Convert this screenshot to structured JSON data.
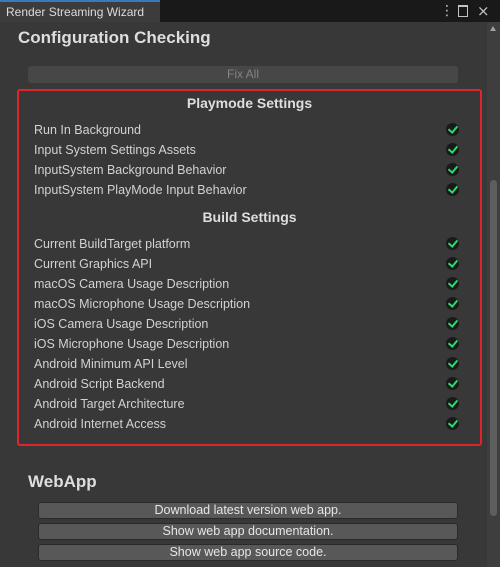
{
  "window": {
    "tab_title": "Render Streaming Wizard",
    "controls": {
      "more": "⋮",
      "close": "×"
    }
  },
  "config": {
    "title": "Configuration Checking",
    "fix_all_label": "Fix All",
    "playmode": {
      "title": "Playmode Settings",
      "items": [
        "Run In Background",
        "Input System Settings Assets",
        "InputSystem Background Behavior",
        "InputSystem PlayMode Input Behavior"
      ]
    },
    "build": {
      "title": "Build Settings",
      "items": [
        "Current BuildTarget platform",
        "Current Graphics API",
        "macOS Camera Usage Description",
        "macOS Microphone Usage Description",
        "iOS Camera Usage Description",
        "iOS Microphone Usage Description",
        "Android Minimum API Level",
        "Android Script Backend",
        "Android Target Architecture",
        "Android Internet Access"
      ]
    },
    "status_icon": "check-circle-icon",
    "status_color": "#2fd86a"
  },
  "webapp": {
    "title": "WebApp",
    "buttons": [
      "Download latest version web app.",
      "Show web app documentation.",
      "Show web app source code."
    ]
  },
  "colors": {
    "highlight_border": "#e0242c",
    "tab_accent": "#3a79bb"
  }
}
